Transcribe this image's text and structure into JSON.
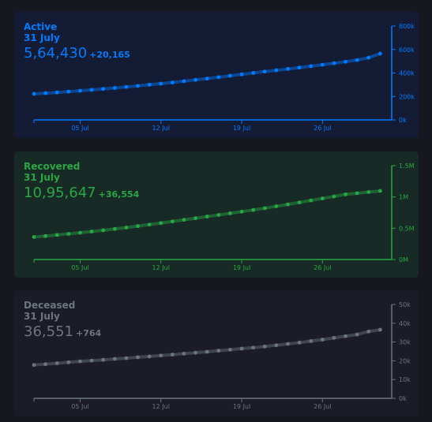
{
  "chart_data": [
    {
      "type": "line",
      "title": "Active",
      "date": "31 July",
      "value_text": "5,64,430",
      "delta_text": "+20,165",
      "color": "#007bff",
      "bg": "#131c34",
      "x_ticks": [
        "05 Jul",
        "12 Jul",
        "19 Jul",
        "26 Jul"
      ],
      "x_tick_days": [
        5,
        12,
        19,
        26
      ],
      "y_ticks": [
        "0k",
        "200k",
        "400k",
        "600k",
        "800k"
      ],
      "y_tick_values": [
        0,
        200000,
        400000,
        600000,
        800000
      ],
      "ylim": [
        0,
        800000
      ],
      "x_days": [
        1,
        2,
        3,
        4,
        5,
        6,
        7,
        8,
        9,
        10,
        11,
        12,
        13,
        14,
        15,
        16,
        17,
        18,
        19,
        20,
        21,
        22,
        23,
        24,
        25,
        26,
        27,
        28,
        29,
        30,
        31
      ],
      "values": [
        222000,
        228000,
        234000,
        241000,
        248000,
        256000,
        264000,
        272000,
        281000,
        290000,
        300000,
        309000,
        319000,
        330000,
        341000,
        352000,
        364000,
        376000,
        388000,
        400000,
        412000,
        423000,
        434000,
        446000,
        458000,
        470000,
        483000,
        496000,
        510000,
        530000,
        564430
      ]
    },
    {
      "type": "line",
      "title": "Recovered",
      "date": "31 July",
      "value_text": "10,95,647",
      "delta_text": "+36,554",
      "color": "#28a745",
      "bg": "#182a25",
      "x_ticks": [
        "05 Jul",
        "12 Jul",
        "19 Jul",
        "26 Jul"
      ],
      "x_tick_days": [
        5,
        12,
        19,
        26
      ],
      "y_ticks": [
        "0M",
        "0.5M",
        "1M",
        "1.5M"
      ],
      "y_tick_values": [
        0,
        500000,
        1000000,
        1500000
      ],
      "ylim": [
        0,
        1500000
      ],
      "x_days": [
        1,
        2,
        3,
        4,
        5,
        6,
        7,
        8,
        9,
        10,
        11,
        12,
        13,
        14,
        15,
        16,
        17,
        18,
        19,
        20,
        21,
        22,
        23,
        24,
        25,
        26,
        27,
        28,
        29,
        30,
        31
      ],
      "values": [
        360000,
        375000,
        392000,
        410000,
        428000,
        447000,
        467000,
        488000,
        510000,
        534000,
        558000,
        583000,
        608000,
        634000,
        660000,
        686000,
        712000,
        738000,
        765000,
        792000,
        820000,
        850000,
        881000,
        912000,
        944000,
        976000,
        1008000,
        1041000,
        1059000,
        1078000,
        1095647
      ]
    },
    {
      "type": "line",
      "title": "Deceased",
      "date": "31 July",
      "value_text": "36,551",
      "delta_text": "+764",
      "color": "#6c757d",
      "bg": "#1c1c26",
      "x_ticks": [
        "05 Jul",
        "12 Jul",
        "19 Jul",
        "26 Jul"
      ],
      "x_tick_days": [
        5,
        12,
        19,
        26
      ],
      "y_ticks": [
        "0k",
        "10k",
        "20k",
        "30k",
        "40k",
        "50k"
      ],
      "y_tick_values": [
        0,
        10000,
        20000,
        30000,
        40000,
        50000
      ],
      "ylim": [
        0,
        50000
      ],
      "x_days": [
        1,
        2,
        3,
        4,
        5,
        6,
        7,
        8,
        9,
        10,
        11,
        12,
        13,
        14,
        15,
        16,
        17,
        18,
        19,
        20,
        21,
        22,
        23,
        24,
        25,
        26,
        27,
        28,
        29,
        30,
        31
      ],
      "values": [
        17800,
        18200,
        18700,
        19200,
        19700,
        20100,
        20500,
        21000,
        21400,
        21900,
        22300,
        22800,
        23300,
        23800,
        24300,
        24800,
        25400,
        25900,
        26500,
        27000,
        27600,
        28300,
        29000,
        29700,
        30500,
        31300,
        32200,
        33100,
        34000,
        35600,
        36551
      ]
    }
  ]
}
